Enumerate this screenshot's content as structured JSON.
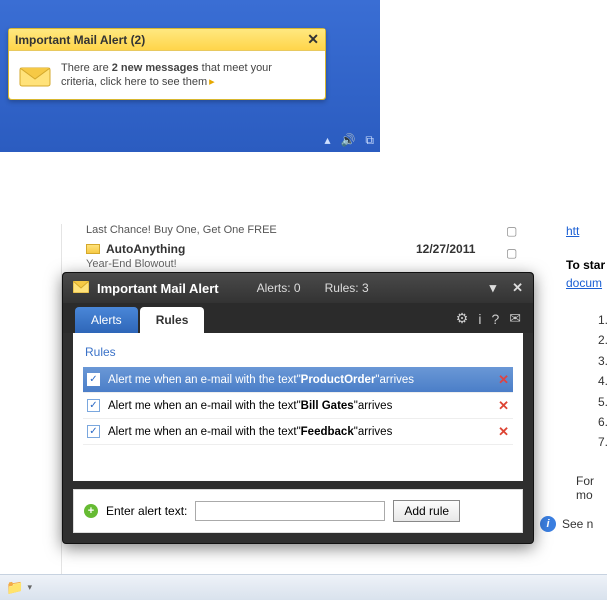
{
  "notification": {
    "title": "Important Mail Alert (2)",
    "line1a": "There are ",
    "bold": "2 new messages",
    "line1b": " that meet your",
    "line2": "criteria, click here to see them",
    "arrow": "▸"
  },
  "mail": {
    "subject1": "Last Chance! Buy One, Get One FREE",
    "from": "AutoAnything",
    "date": "12/27/2011",
    "subject2": "Year-End Blowout!",
    "link_htt": "htt",
    "tostart": "To star",
    "docum": "docum",
    "formore": "For mo",
    "see": "See n",
    "nums": [
      "1.",
      "2.",
      "3.",
      "4.",
      "5.",
      "6.",
      "7."
    ]
  },
  "dialog": {
    "title": "Important Mail Alert",
    "alerts_label": "Alerts: 0",
    "rules_label": "Rules: 3",
    "tab_alerts": "Alerts",
    "tab_rules": "Rules",
    "section": "Rules",
    "rule_prefix": "Alert me when an e-mail with the text ",
    "rule_suffix": " arrives",
    "quote_open": "\"",
    "quote_close": "\"",
    "rules": [
      {
        "keyword": "ProductOrder",
        "selected": true
      },
      {
        "keyword": "Bill Gates",
        "selected": false
      },
      {
        "keyword": "Feedback",
        "selected": false
      }
    ],
    "add_label": "Enter alert text:",
    "add_input": "",
    "add_button": "Add rule"
  }
}
